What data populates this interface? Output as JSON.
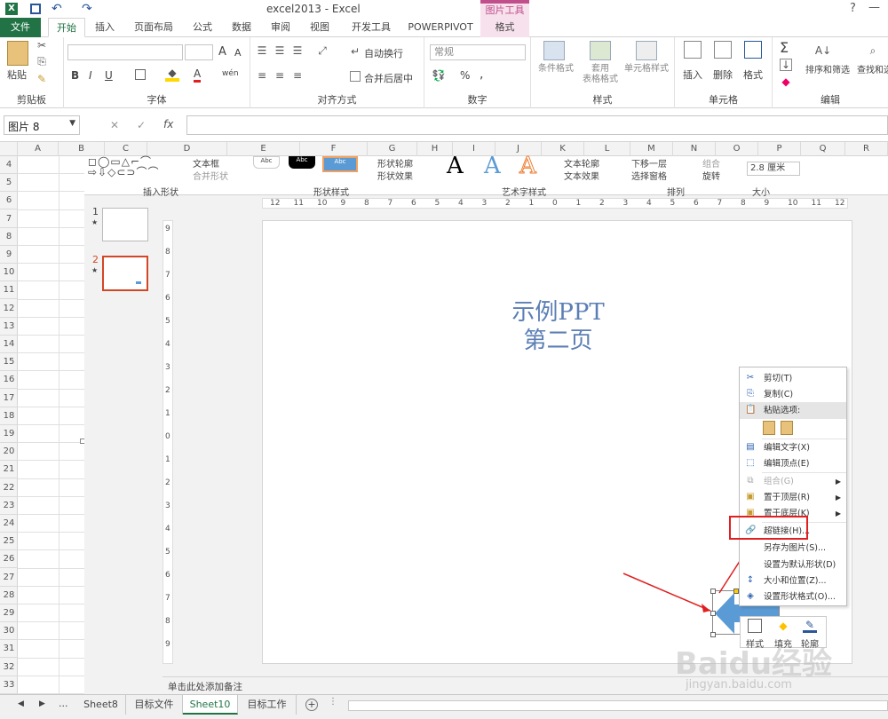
{
  "title_bar": {
    "window_title": "excel2013 - Excel",
    "contextual_group": "图片工具",
    "help": "?",
    "min": "—",
    "max": "□"
  },
  "tabs": [
    "文件",
    "开始",
    "插入",
    "页面布局",
    "公式",
    "数据",
    "审阅",
    "视图",
    "开发工具",
    "POWERPIVOT",
    "格式"
  ],
  "ribbon": {
    "clipboard": {
      "paste": "粘贴",
      "label": "剪贴板"
    },
    "font": {
      "label": "字体",
      "bold": "B",
      "italic": "I",
      "underline": "U",
      "grow": "A",
      "shrink": "A",
      "color": "A",
      "wen": "wén"
    },
    "alignment": {
      "wrap": "自动换行",
      "merge": "合并后居中",
      "label": "对齐方式"
    },
    "number": {
      "format": "常规",
      "percent": "%",
      "comma": ",",
      "label": "数字"
    },
    "styles": {
      "cond": "条件格式",
      "table_top": "套用",
      "table_bottom": "表格格式",
      "cell": "单元格样式",
      "label": "样式"
    },
    "cells": {
      "insert": "插入",
      "delete": "删除",
      "format": "格式",
      "label": "单元格"
    },
    "editing": {
      "sort": "排序和筛选",
      "find": "查找和选",
      "sum": "Σ",
      "label": "编辑"
    }
  },
  "formula_bar": {
    "name_box": "图片 8",
    "cancel": "✕",
    "enter": "✓",
    "fx": "fx",
    "value": ""
  },
  "columns": [
    "A",
    "B",
    "C",
    "D",
    "E",
    "F",
    "G",
    "H",
    "I",
    "J",
    "K",
    "L",
    "M",
    "N",
    "O",
    "P",
    "Q",
    "R"
  ],
  "rows": [
    "4",
    "5",
    "6",
    "7",
    "8",
    "9",
    "10",
    "11",
    "12",
    "13",
    "14",
    "15",
    "16",
    "17",
    "18",
    "19",
    "20",
    "21",
    "22",
    "23",
    "24",
    "25",
    "26",
    "27",
    "28",
    "29",
    "30",
    "31",
    "32",
    "33"
  ],
  "ppt": {
    "ribbon": {
      "text_box": "文本框",
      "merge_shapes": "合并形状",
      "insert_shapes_label": "插入形状",
      "shape_fill": "形状轮廓",
      "shape_effects": "形状效果",
      "shape_styles_label": "形状样式",
      "abc1": "Abc",
      "abc2": "Abc",
      "abc3": "Abc",
      "text_fill": "文本轮廓",
      "text_effects": "文本效果",
      "wordart_label": "艺术字样式",
      "send_back": "下移一层",
      "selection_pane": "选择窗格",
      "group": "组合",
      "rotate": "旋转",
      "arrange_label": "排列",
      "size_value": "2.8 厘米",
      "size_label": "大小",
      "wordart_a": "A"
    },
    "slides": [
      {
        "number": "1",
        "star": "★"
      },
      {
        "number": "2",
        "star": "★"
      }
    ],
    "slide_title_line1": "示例PPT",
    "slide_title_line2": "第二页",
    "notes_placeholder": "单击此处添加备注",
    "ruler_h": [
      "12",
      "11",
      "10",
      "9",
      "8",
      "7",
      "6",
      "5",
      "4",
      "3",
      "2",
      "1",
      "0",
      "1",
      "2",
      "3",
      "4",
      "5",
      "6",
      "7",
      "8",
      "9",
      "10",
      "11",
      "12"
    ],
    "ruler_v": [
      "9",
      "8",
      "7",
      "6",
      "5",
      "4",
      "3",
      "2",
      "1",
      "0",
      "1",
      "2",
      "3",
      "4",
      "5",
      "6",
      "7",
      "8",
      "9"
    ],
    "mini_toolbar": {
      "style": "样式",
      "fill": "填充",
      "outline": "轮廓"
    }
  },
  "context_menu": {
    "items": [
      {
        "icon": "cut-icon",
        "label": "剪切(T)"
      },
      {
        "icon": "copy-icon",
        "label": "复制(C)"
      },
      {
        "icon": "paste-icon",
        "label": "粘贴选项:"
      },
      {
        "icon": "edit-text-icon",
        "label": "编辑文字(X)"
      },
      {
        "icon": "edit-points-icon",
        "label": "编辑顶点(E)"
      },
      {
        "icon": "group-icon",
        "label": "组合(G)"
      },
      {
        "icon": "bring-front-icon",
        "label": "置于顶层(R)"
      },
      {
        "icon": "send-back-icon",
        "label": "置于底层(K)"
      },
      {
        "icon": "hyperlink-icon",
        "label": "超链接(H)..."
      },
      {
        "icon": "",
        "label": "另存为图片(S)..."
      },
      {
        "icon": "",
        "label": "设置为默认形状(D)"
      },
      {
        "icon": "size-icon",
        "label": "大小和位置(Z)..."
      },
      {
        "icon": "format-shape-icon",
        "label": "设置形状格式(O)..."
      }
    ]
  },
  "sheet_tabs": [
    "Sheet8",
    "目标文件",
    "Sheet10",
    "目标工作"
  ],
  "active_sheet": "Sheet10",
  "watermark": {
    "line1": "Baidu经验",
    "line2": "jingyan.baidu.com"
  },
  "colors": {
    "excel_green": "#217346",
    "contextual_pink": "#c0508c",
    "accent_blue": "#5b9bd5",
    "highlight_red": "#e02020"
  }
}
